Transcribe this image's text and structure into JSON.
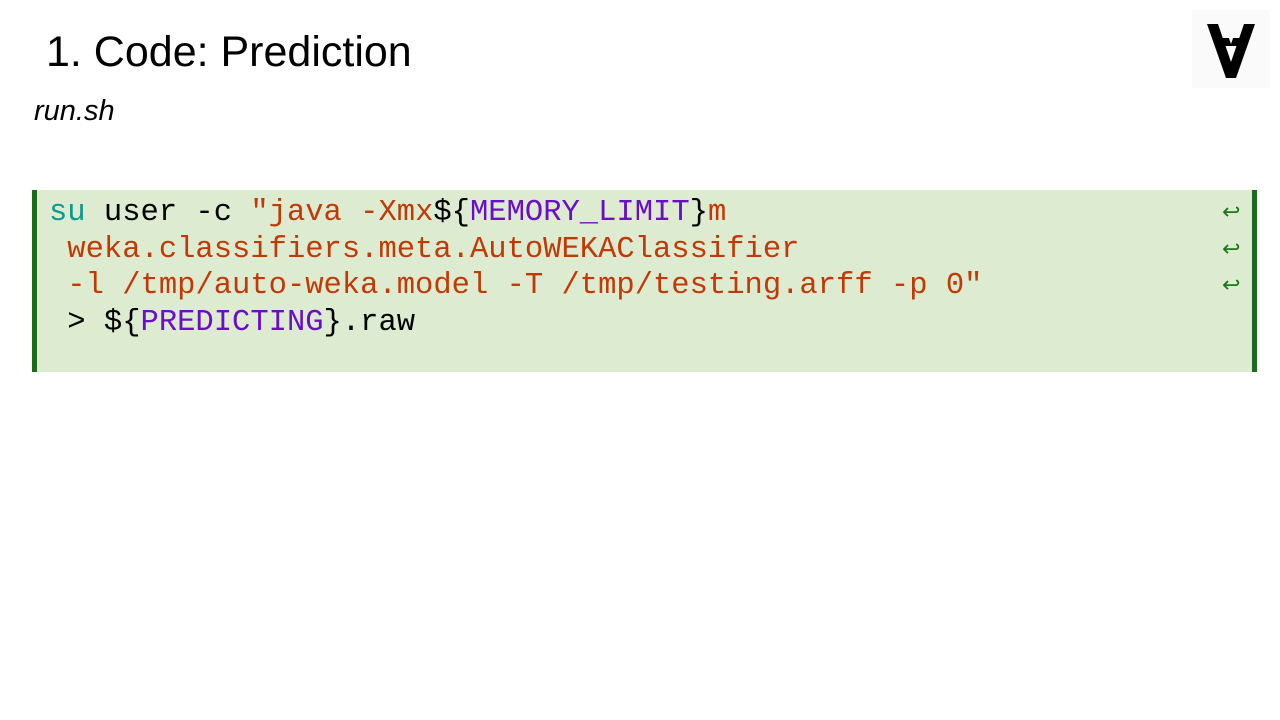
{
  "slide": {
    "title": "1. Code: Prediction",
    "filename": "run.sh"
  },
  "logo": {
    "icon": "inverted-a-logo-icon",
    "color": "#000000"
  },
  "code": {
    "background": "#ddebd0",
    "border_color": "#1a6b1a",
    "wrap_glyph": "↩",
    "line1": {
      "cmd": "su",
      "plain1": " user -c ",
      "str1": "\"java -Xmx",
      "plain2": "${",
      "var": "MEMORY_LIMIT",
      "plain3": "}",
      "str2": "m"
    },
    "line2": {
      "str": " weka.classifiers.meta.AutoWEKAClassifier"
    },
    "line3": {
      "str": " -l /tmp/auto-weka.model -T /tmp/testing.arff -p 0\""
    },
    "line4": {
      "plain1": " > ${",
      "var": "PREDICTING",
      "plain2": "}.raw"
    }
  }
}
